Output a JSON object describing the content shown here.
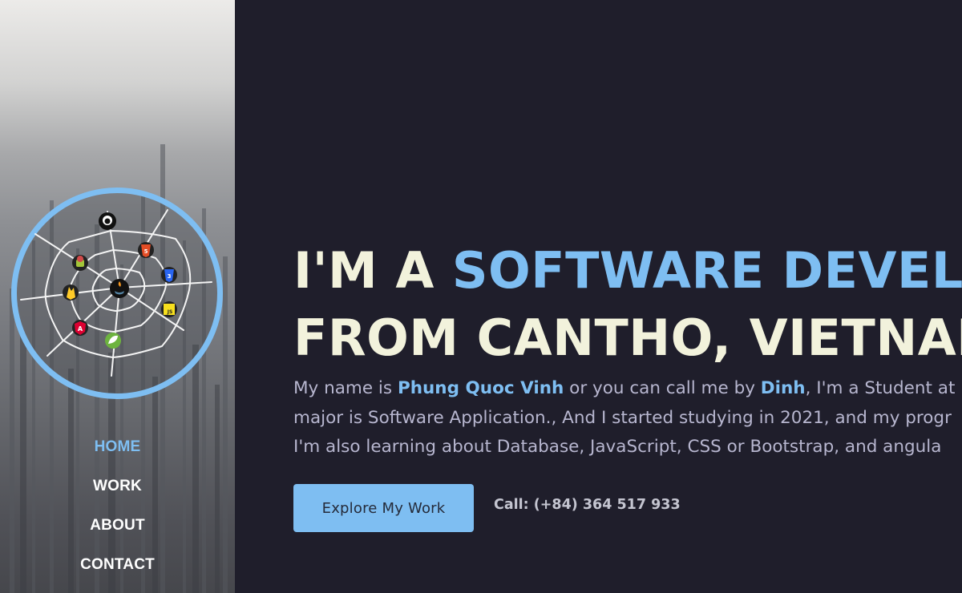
{
  "nav": {
    "items": [
      {
        "label": "HOME",
        "active": true
      },
      {
        "label": "WORK",
        "active": false
      },
      {
        "label": "ABOUT",
        "active": false
      },
      {
        "label": "CONTACT",
        "active": false
      }
    ]
  },
  "logo": {
    "icons": [
      "github-icon",
      "html5-icon",
      "css3-icon",
      "javascript-icon",
      "spring-icon",
      "angular-icon",
      "firebase-icon",
      "android-icon",
      "java-icon"
    ],
    "ring_color": "#7ebef2"
  },
  "hero": {
    "line1_prefix": "I'M A ",
    "line1_highlight": "SOFTWARE DEVELOPER",
    "line2": "FROM CANTHO, VIETNAM",
    "intro_1a": "My name is ",
    "intro_name": "Phung Quoc Vinh",
    "intro_1b": " or you can call me by ",
    "intro_nick": "Dinh",
    "intro_1c": ", I'm a Student at",
    "intro_2": "major is Software Application., And I started studying in 2021, and my progr",
    "intro_3": "I'm also learning about Database, JavaScript, CSS or Bootstrap, and angula",
    "cta_label": "Explore My Work",
    "call_text": "Call: (+84) 364 517 933"
  },
  "colors": {
    "accent": "#7ebef2",
    "background": "#1f1e2b",
    "headline": "#f2f2dc",
    "body_text": "#b7b6cf"
  }
}
